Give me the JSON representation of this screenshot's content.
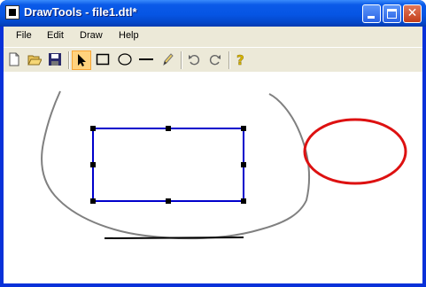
{
  "window": {
    "title": "DrawTools - file1.dtl*",
    "icon": "app-icon",
    "buttons": {
      "minimize": "minimize-icon",
      "maximize": "maximize-icon",
      "close": "close-icon"
    }
  },
  "menu": {
    "items": [
      {
        "label": "File"
      },
      {
        "label": "Edit"
      },
      {
        "label": "Draw"
      },
      {
        "label": "Help"
      }
    ]
  },
  "toolbar": {
    "tools": [
      {
        "name": "new-icon"
      },
      {
        "name": "open-icon"
      },
      {
        "name": "save-icon"
      },
      {
        "name": "pointer-icon",
        "active": true
      },
      {
        "name": "rectangle-icon"
      },
      {
        "name": "ellipse-icon"
      },
      {
        "name": "line-icon"
      },
      {
        "name": "pencil-icon"
      },
      {
        "name": "undo-icon"
      },
      {
        "name": "redo-icon"
      },
      {
        "name": "help-icon"
      }
    ]
  },
  "colors": {
    "rectangle": "#0000cc",
    "ellipse": "#dd1111",
    "pencil": "#808080",
    "line": "#000000",
    "handle": "#000000"
  }
}
